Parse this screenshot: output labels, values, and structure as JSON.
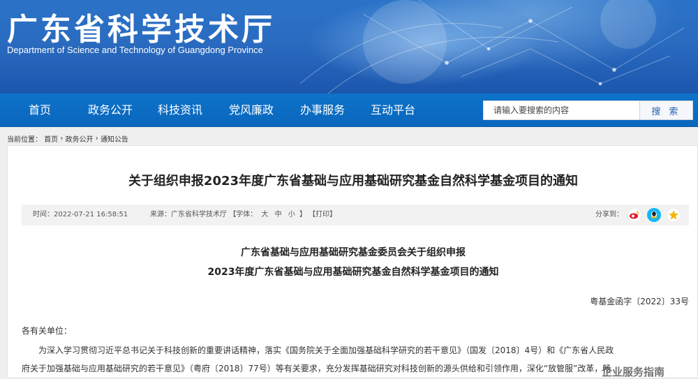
{
  "header": {
    "site_title": "广东省科学技术厅",
    "site_subtitle": "Department of Science and Technology of Guangdong Province"
  },
  "nav": {
    "items": [
      "首页",
      "政务公开",
      "科技资讯",
      "党风廉政",
      "办事服务",
      "互动平台"
    ],
    "search_placeholder": "请输入要搜索的内容",
    "search_button": "搜 索"
  },
  "breadcrumb": {
    "label": "当前位置：",
    "items": [
      "首页",
      "政务公开",
      "通知公告"
    ],
    "separator": "›"
  },
  "article": {
    "title": "关于组织申报2023年度广东省基础与应用基础研究基金自然科学基金项目的通知",
    "meta": {
      "time": "时间：2022-07-21 16:58:51",
      "source": "来源：广东省科学技术厅",
      "font_label": "【字体：",
      "font_large": "大",
      "font_medium": "中",
      "font_small": "小",
      "font_close": "】",
      "print": "【打印】",
      "share_label": "分享到："
    },
    "doc_heading_line1": "广东省基础与应用基础研究基金委员会关于组织申报",
    "doc_heading_line2": "2023年度广东省基础与应用基础研究基金自然科学基金项目的通知",
    "doc_number": "粤基金函字〔2022〕33号",
    "salutation": "各有关单位：",
    "body_line1": "为深入学习贯彻习近平总书记关于科技创新的重要讲话精神，落实《国务院关于全面加强基础科学研究的若干意见》（国发〔2018〕4号）和《广东省人民政",
    "body_line2": "府关于加强基础与应用基础研究的若干意见》（粤府〔2018〕77号）等有关要求，充分发挥基础研究对科技创新的源头供给和引领作用，深化“放管服”改革，畅"
  },
  "watermark": "企业服务指南",
  "colors": {
    "nav_blue": "#0a66bd",
    "banner_blue": "#2a6bc0",
    "weibo": "#e6162d",
    "qq": "#12b7f5",
    "qzone": "#f5b400"
  }
}
